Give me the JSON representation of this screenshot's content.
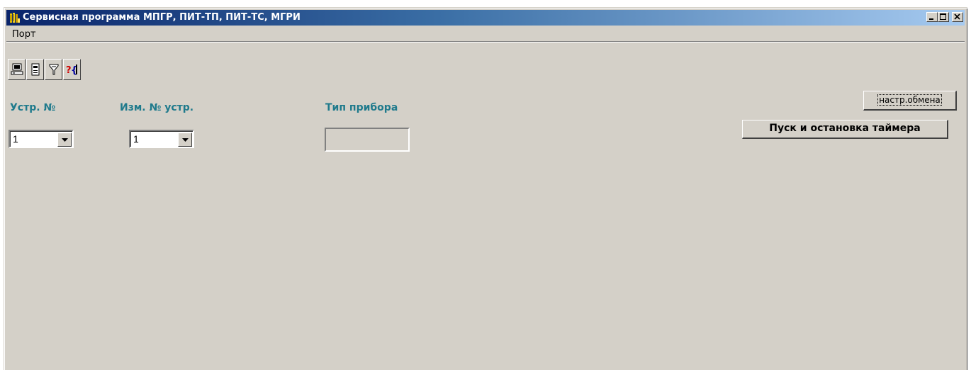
{
  "window": {
    "title": "Сервисная программа МПГР, ПИТ-ТП, ПИТ-ТС, МГРИ",
    "controls": [
      "minimize-icon",
      "maximize-icon",
      "close-icon"
    ]
  },
  "menu": {
    "items": [
      {
        "label": "Порт"
      }
    ]
  },
  "toolbar": {
    "buttons": [
      {
        "icon": "computer-icon"
      },
      {
        "icon": "device-icon"
      },
      {
        "icon": "filter-icon"
      },
      {
        "icon": "help-code-icon"
      }
    ]
  },
  "form": {
    "device_no_label": "Устр. №",
    "device_no_value": "1",
    "change_device_no_label": "Изм. № устр.",
    "change_device_no_value": "1",
    "device_type_label": "Тип прибора",
    "device_type_value": ""
  },
  "buttons": {
    "exchange_settings": "настр.обмена",
    "timer_toggle": "Пуск и остановка таймера"
  },
  "colors": {
    "titlebar_start": "#0a246a",
    "titlebar_end": "#a6caf0",
    "label_color": "#1f7a8c",
    "face": "#d4d0c8"
  }
}
